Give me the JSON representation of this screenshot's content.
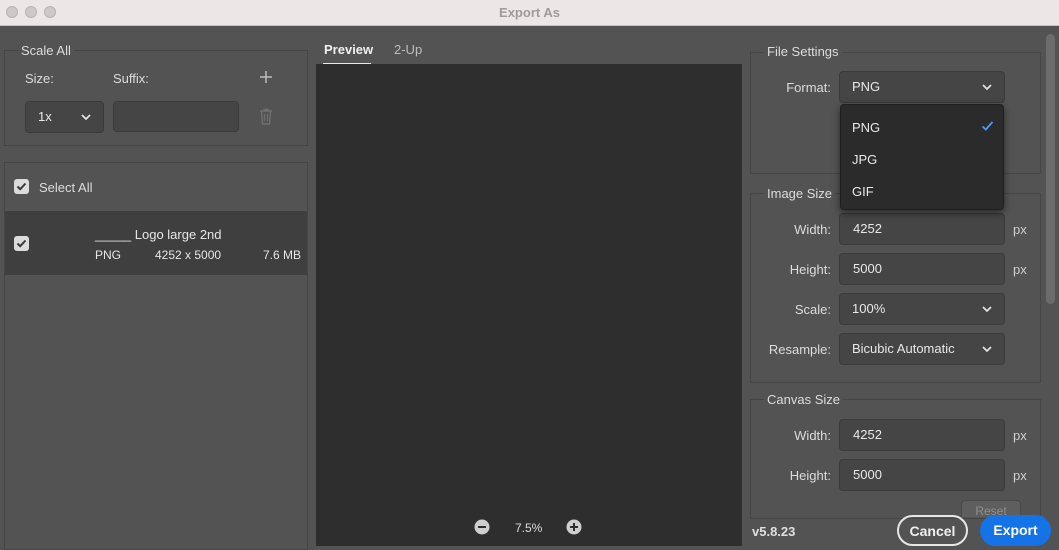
{
  "window": {
    "title": "Export As"
  },
  "scale_all": {
    "legend": "Scale All",
    "size_label": "Size:",
    "suffix_label": "Suffix:",
    "size_value": "1x",
    "suffix_value": ""
  },
  "assets": {
    "select_all": "Select All",
    "items": [
      {
        "name": "_____ Logo large 2nd",
        "format": "PNG",
        "dimensions": "4252 x 5000",
        "file_size": "7.6 MB"
      }
    ]
  },
  "preview": {
    "tabs": [
      "Preview",
      "2-Up"
    ],
    "zoom": "7.5%"
  },
  "file_settings": {
    "legend": "File Settings",
    "format_label": "Format:",
    "format_value": "PNG",
    "options": [
      "PNG",
      "JPG",
      "GIF"
    ]
  },
  "image_size": {
    "legend": "Image Size",
    "width_label": "Width:",
    "width_value": "4252",
    "height_label": "Height:",
    "height_value": "5000",
    "scale_label": "Scale:",
    "scale_value": "100%",
    "resample_label": "Resample:",
    "resample_value": "Bicubic Automatic",
    "unit": "px"
  },
  "canvas_size": {
    "legend": "Canvas Size",
    "width_label": "Width:",
    "width_value": "4252",
    "height_label": "Height:",
    "height_value": "5000",
    "unit": "px",
    "reset_label": "Reset"
  },
  "footer": {
    "version": "v5.8.23",
    "cancel": "Cancel",
    "export": "Export"
  },
  "colors": {
    "accent": "#1473e6",
    "background": "#535353",
    "preview_bg": "#2e2e2e"
  }
}
